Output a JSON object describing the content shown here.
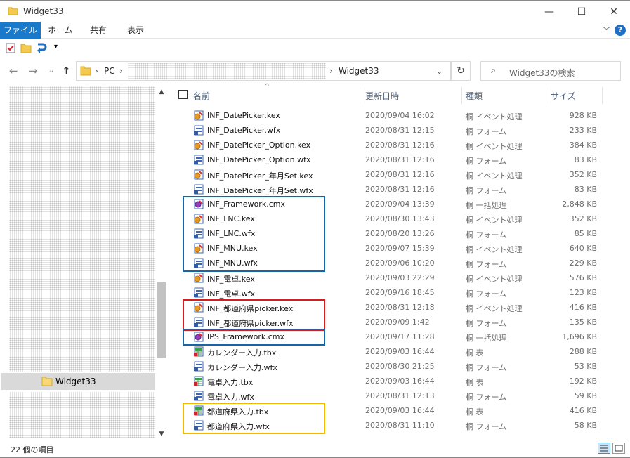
{
  "window": {
    "title": "Widget33",
    "minimize": "—",
    "maximize": "☐",
    "close": "✕"
  },
  "ribbon": {
    "tabs": [
      "ファイル",
      "ホーム",
      "共有",
      "表示"
    ],
    "help": "?"
  },
  "address": {
    "pc": "PC",
    "folder": "Widget33",
    "search_placeholder": "Widget33の検索"
  },
  "nav": {
    "selected": "Widget33"
  },
  "columns": {
    "name": "名前",
    "date": "更新日時",
    "type": "種類",
    "size": "サイズ"
  },
  "files": [
    {
      "name": "INF_DatePicker.kex",
      "date": "2020/09/04 16:02",
      "type": "桐 イベント処理",
      "size": "928 KB",
      "icon": "kex-icon"
    },
    {
      "name": "INF_DatePicker.wfx",
      "date": "2020/08/31 12:15",
      "type": "桐 フォーム",
      "size": "233 KB",
      "icon": "wfx-icon"
    },
    {
      "name": "INF_DatePicker_Option.kex",
      "date": "2020/08/31 12:16",
      "type": "桐 イベント処理",
      "size": "384 KB",
      "icon": "kex-icon"
    },
    {
      "name": "INF_DatePicker_Option.wfx",
      "date": "2020/08/31 12:16",
      "type": "桐 フォーム",
      "size": "83 KB",
      "icon": "wfx-icon"
    },
    {
      "name": "INF_DatePicker_年月Set.kex",
      "date": "2020/08/31 12:16",
      "type": "桐 イベント処理",
      "size": "352 KB",
      "icon": "kex-icon"
    },
    {
      "name": "INF_DatePicker_年月Set.wfx",
      "date": "2020/08/31 12:16",
      "type": "桐 フォーム",
      "size": "83 KB",
      "icon": "wfx-icon"
    },
    {
      "name": "INF_Framework.cmx",
      "date": "2020/09/04 13:39",
      "type": "桐 一括処理",
      "size": "2,848 KB",
      "icon": "cmx-icon"
    },
    {
      "name": "INF_LNC.kex",
      "date": "2020/08/30 13:43",
      "type": "桐 イベント処理",
      "size": "352 KB",
      "icon": "kex-icon"
    },
    {
      "name": "INF_LNC.wfx",
      "date": "2020/08/20 13:26",
      "type": "桐 フォーム",
      "size": "85 KB",
      "icon": "wfx-icon"
    },
    {
      "name": "INF_MNU.kex",
      "date": "2020/09/07 15:39",
      "type": "桐 イベント処理",
      "size": "640 KB",
      "icon": "kex-icon"
    },
    {
      "name": "INF_MNU.wfx",
      "date": "2020/09/06 10:20",
      "type": "桐 フォーム",
      "size": "229 KB",
      "icon": "wfx-icon"
    },
    {
      "name": "INF_電卓.kex",
      "date": "2020/09/03 22:29",
      "type": "桐 イベント処理",
      "size": "576 KB",
      "icon": "kex-icon"
    },
    {
      "name": "INF_電卓.wfx",
      "date": "2020/09/16 18:45",
      "type": "桐 フォーム",
      "size": "123 KB",
      "icon": "wfx-icon"
    },
    {
      "name": "INF_都道府県picker.kex",
      "date": "2020/08/31 12:18",
      "type": "桐 イベント処理",
      "size": "416 KB",
      "icon": "kex-icon"
    },
    {
      "name": "INF_都道府県picker.wfx",
      "date": "2020/09/09 1:42",
      "type": "桐 フォーム",
      "size": "135 KB",
      "icon": "wfx-icon"
    },
    {
      "name": "IPS_Framework.cmx",
      "date": "2020/09/17 11:28",
      "type": "桐 一括処理",
      "size": "1,696 KB",
      "icon": "cmx-icon"
    },
    {
      "name": "カレンダー入力.tbx",
      "date": "2020/09/03 16:44",
      "type": "桐 表",
      "size": "288 KB",
      "icon": "tbx-icon"
    },
    {
      "name": "カレンダー入力.wfx",
      "date": "2020/08/30 21:25",
      "type": "桐 フォーム",
      "size": "53 KB",
      "icon": "wfx-icon"
    },
    {
      "name": "電卓入力.tbx",
      "date": "2020/09/03 16:44",
      "type": "桐 表",
      "size": "192 KB",
      "icon": "tbx-icon"
    },
    {
      "name": "電卓入力.wfx",
      "date": "2020/08/31 12:13",
      "type": "桐 フォーム",
      "size": "59 KB",
      "icon": "wfx-icon"
    },
    {
      "name": "都道府県入力.tbx",
      "date": "2020/09/03 16:44",
      "type": "桐 表",
      "size": "416 KB",
      "icon": "tbx-icon"
    },
    {
      "name": "都道府県入力.wfx",
      "date": "2020/08/31 11:10",
      "type": "桐 フォーム",
      "size": "58 KB",
      "icon": "wfx-icon"
    }
  ],
  "highlights": [
    {
      "color": "#1565a8",
      "from": 6,
      "to": 10
    },
    {
      "color": "#d81b1b",
      "from": 13,
      "to": 14
    },
    {
      "color": "#1565a8",
      "from": 15,
      "to": 15
    },
    {
      "color": "#f5b800",
      "from": 20,
      "to": 21
    }
  ],
  "status": {
    "count": "22 個の項目"
  }
}
